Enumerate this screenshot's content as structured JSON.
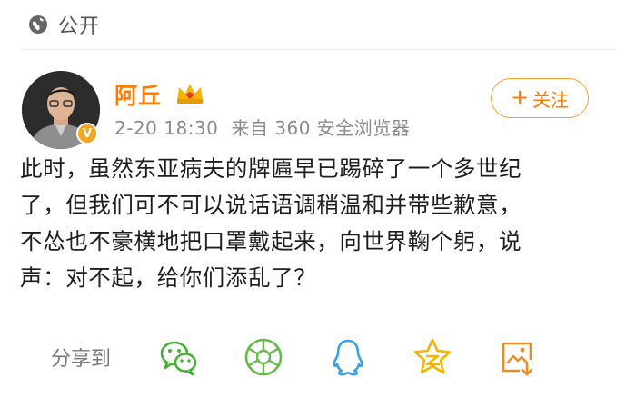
{
  "header": {
    "visibility_icon": "globe-icon",
    "visibility_label": "公开"
  },
  "author": {
    "name": "阿丘",
    "badge_icon": "crown-member-icon",
    "verified_icon": "verified-v-icon",
    "verified_glyph": "V",
    "time": "2-20 18:30",
    "source": "来自 360 安全浏览器",
    "follow_icon": "plus-icon",
    "follow_plus": "+",
    "follow_label": "关注"
  },
  "post": {
    "lines": [
      "此时，虽然东亚病夫的牌匾早已踢碎了一个多世纪",
      "了，但我们可不可以说话语调稍温和并带些歉意，",
      "不怂也不豪横地把口罩戴起来，向世界鞠个躬，说",
      "声：对不起，给你们添乱了？"
    ]
  },
  "share": {
    "label": "分享到",
    "targets": [
      "wechat-icon",
      "moments-icon",
      "qq-icon",
      "qzone-icon",
      "save-image-icon"
    ]
  },
  "colors": {
    "accent": "#ff7a00",
    "wechat": "#45b035",
    "moments": "#63b94a",
    "qq": "#3aa1e8",
    "qzone": "#f5b400",
    "save": "#f08a24",
    "meta_text": "#8a8a8a"
  }
}
